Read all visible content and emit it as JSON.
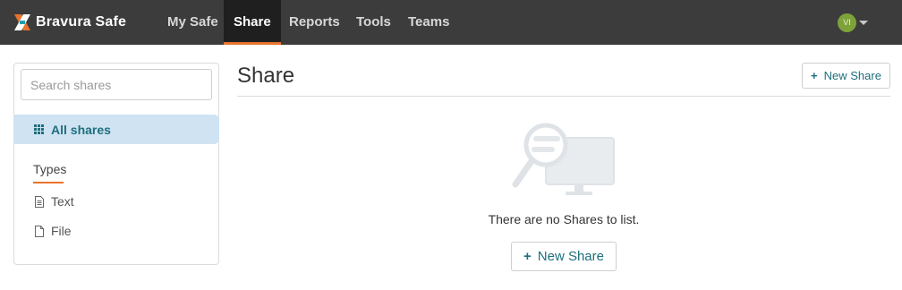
{
  "app": {
    "brand_name": "Bravura Safe"
  },
  "nav": {
    "items": [
      {
        "label": "My Safe",
        "active": false
      },
      {
        "label": "Share",
        "active": true
      },
      {
        "label": "Reports",
        "active": false
      },
      {
        "label": "Tools",
        "active": false
      },
      {
        "label": "Teams",
        "active": false
      }
    ]
  },
  "user": {
    "initials": "VI",
    "avatar_color": "#7ea23a"
  },
  "sidebar": {
    "search_placeholder": "Search shares",
    "all_shares_label": "All shares",
    "types_heading": "Types",
    "types": [
      {
        "label": "Text",
        "icon": "text-document-icon"
      },
      {
        "label": "File",
        "icon": "file-icon"
      }
    ]
  },
  "main": {
    "title": "Share",
    "new_share_label": "New Share",
    "empty_message": "There are no Shares to list.",
    "empty_new_share_label": "New Share"
  },
  "colors": {
    "topbar": "#3c3c3c",
    "accent": "#e8742c",
    "primary_text": "#1e6f7d",
    "selected_bg": "#cfe3f3"
  }
}
